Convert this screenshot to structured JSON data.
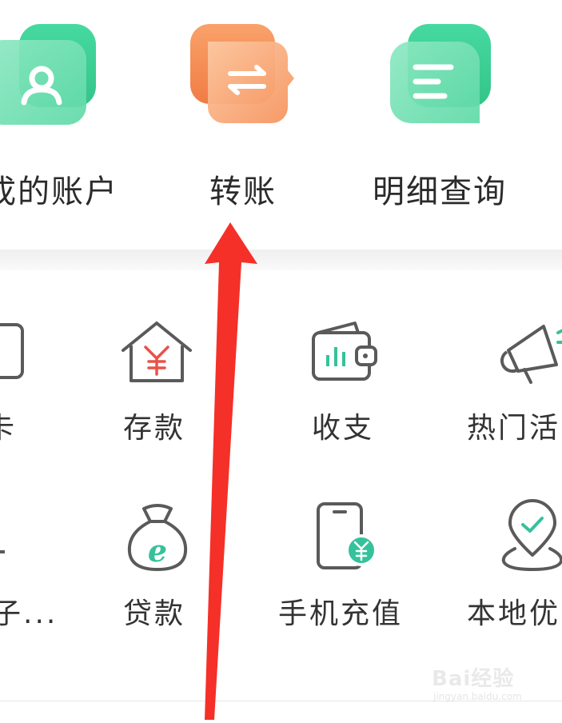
{
  "quick_actions": [
    {
      "label": "我的账户",
      "visible_label": "戎的账户",
      "icon": "user-icon",
      "color": "#3fcf96"
    },
    {
      "label": "转账",
      "icon": "transfer-icon",
      "color": "#f5874d"
    },
    {
      "label": "明细查询",
      "icon": "list-detail-icon",
      "color": "#3fcf96"
    }
  ],
  "services_row1": [
    {
      "label": "卡",
      "icon": "card-icon"
    },
    {
      "label": "存款",
      "icon": "deposit-house-icon"
    },
    {
      "label": "收支",
      "icon": "wallet-chart-icon"
    },
    {
      "label": "热门活",
      "icon": "megaphone-icon"
    }
  ],
  "services_row2": [
    {
      "label": "子...",
      "icon": "partial-icon"
    },
    {
      "label": "贷款",
      "icon": "loan-bag-icon"
    },
    {
      "label": "手机充值",
      "icon": "phone-recharge-icon"
    },
    {
      "label": "本地优",
      "icon": "location-pin-icon"
    }
  ],
  "annotation": {
    "icon": "red-arrow-icon",
    "color": "#f53028"
  },
  "watermark": {
    "text": "Bai经验",
    "sub": "jingyan.baidu.com"
  },
  "colors": {
    "green": "#3fcf96",
    "orange": "#f5874d",
    "gray_icon": "#5a5a5a",
    "red_accent": "#e8524a",
    "teal_accent": "#35c29b"
  }
}
